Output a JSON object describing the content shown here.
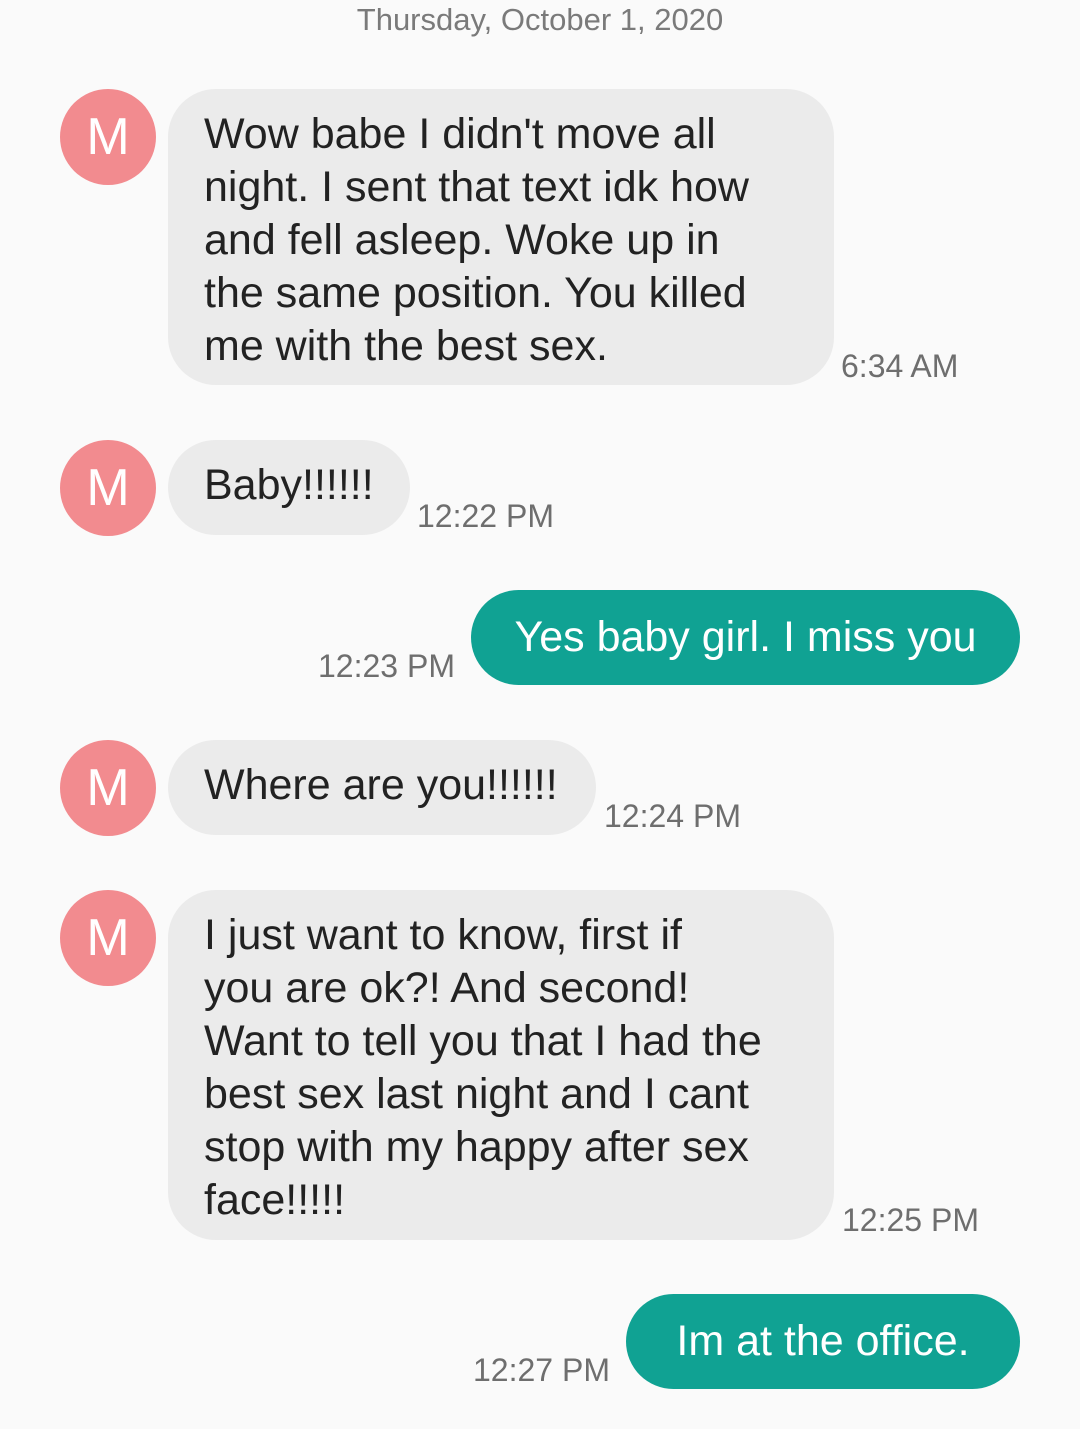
{
  "conversation": {
    "date": "Thursday, October 1, 2020",
    "contact_initial": "M",
    "colors": {
      "background": "#fafafa",
      "avatar": "#f28b8f",
      "incoming_bubble": "#ebebeb",
      "outgoing_bubble": "#10a293"
    },
    "messages": [
      {
        "direction": "incoming",
        "text": "Wow babe I didn't move all\nnight. I sent that text idk how\nand fell asleep. Woke up in\nthe same position. You killed\nme with the best sex.",
        "time": "6:34 AM"
      },
      {
        "direction": "incoming",
        "text": "Baby!!!!!!",
        "time": "12:22 PM"
      },
      {
        "direction": "outgoing",
        "text": "Yes baby girl. I miss you",
        "time": "12:23 PM"
      },
      {
        "direction": "incoming",
        "text": "Where are you!!!!!!",
        "time": "12:24 PM"
      },
      {
        "direction": "incoming",
        "text": "I just want to know, first if\nyou are ok?! And second!\nWant to tell you that I had the\nbest sex last night and I cant\nstop with my happy after sex\nface!!!!!",
        "time": "12:25 PM"
      },
      {
        "direction": "outgoing",
        "text": "Im at the office.",
        "time": "12:27 PM"
      }
    ]
  }
}
